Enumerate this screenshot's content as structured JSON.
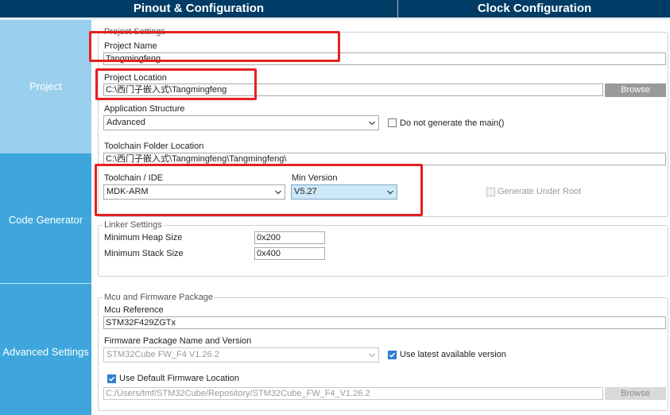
{
  "tabs": {
    "pinout": "Pinout & Configuration",
    "clock": "Clock Configuration"
  },
  "sidebar": {
    "project": "Project",
    "code_generator": "Code Generator",
    "advanced_settings": "Advanced Settings"
  },
  "project_settings": {
    "group_title": "Project Settings",
    "project_name_label": "Project Name",
    "project_name_value": "Tangmingfeng",
    "project_location_label": "Project Location",
    "project_location_value": "C:\\西门子嵌入式\\Tangmingfeng",
    "browse_label": "Browse",
    "app_structure_label": "Application Structure",
    "app_structure_value": "Advanced",
    "no_main_label": "Do not generate the main()",
    "toolchain_folder_label": "Toolchain Folder Location",
    "toolchain_folder_value": "C:\\西门子嵌入式\\Tangmingfeng\\Tangmingfeng\\",
    "toolchain_ide_label": "Toolchain / IDE",
    "toolchain_ide_value": "MDK-ARM",
    "min_version_label": "Min Version",
    "min_version_value": "V5.27",
    "generate_under_root_label": "Generate Under Root"
  },
  "linker_settings": {
    "group_title": "Linker Settings",
    "heap_label": "Minimum Heap Size",
    "heap_value": "0x200",
    "stack_label": "Minimum Stack Size",
    "stack_value": "0x400"
  },
  "mcu_firmware": {
    "group_title": "Mcu and Firmware Package",
    "mcu_ref_label": "Mcu Reference",
    "mcu_ref_value": "STM32F429ZGTx",
    "fw_label": "Firmware Package Name and Version",
    "fw_value": "STM32Cube FW_F4 V1.26.2",
    "use_latest_label": "Use latest available version",
    "use_default_label": "Use Default Firmware Location",
    "fw_location_value": "C:/Users/tmf/STM32Cube/Repository/STM32Cube_FW_F4_V1.26.2",
    "browse_label": "Browse"
  },
  "state": {
    "no_main_checked": false,
    "generate_under_root_checked": false,
    "use_latest_checked": true,
    "use_default_checked": true
  },
  "colors": {
    "topbar": "#003c66",
    "sidebar": "#3ea6dc",
    "sidebar_selected": "#9acfee",
    "annotation": "#e52020",
    "checkbox_checked": "#2f7fd1",
    "min_version_highlight": "#cde8f7"
  }
}
